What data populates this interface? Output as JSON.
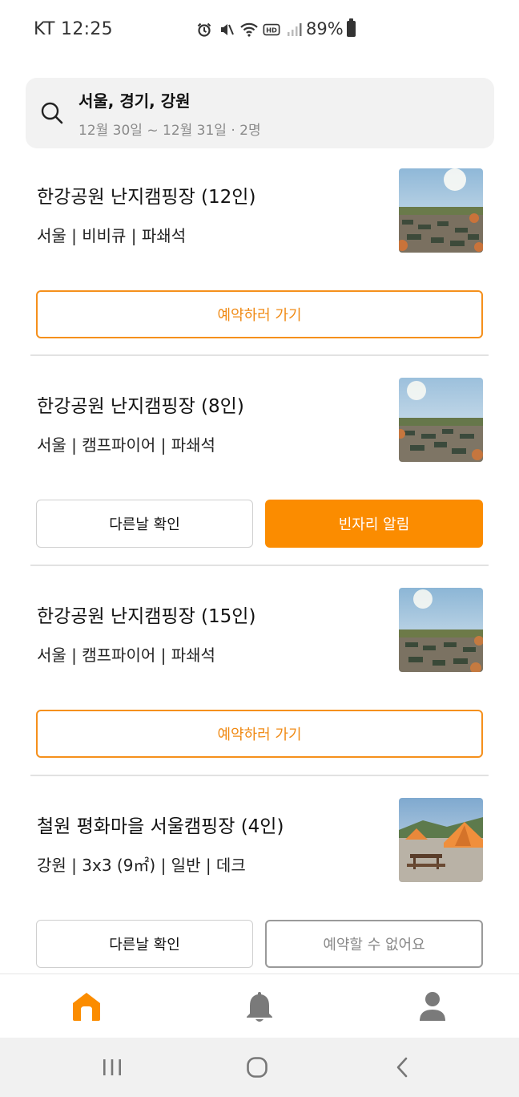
{
  "status_bar": {
    "carrier_time": "KT 12:25",
    "battery": "89%",
    "icons": [
      "alarm-icon",
      "mute-icon",
      "wifi-icon",
      "hd-icon",
      "signal-icon",
      "battery-icon"
    ]
  },
  "search": {
    "title": "서울, 경기, 강원",
    "subtitle": "12월 30일 ~ 12월 31일 · 2명",
    "icon": "search-icon"
  },
  "listings": [
    {
      "title": "한강공원 난지캠핑장 (12인)",
      "tags": "서울 | 비비큐 | 파쇄석",
      "buttons": [
        {
          "label": "예약하러 가기",
          "style": "outline-orange"
        }
      ]
    },
    {
      "title": "한강공원 난지캠핑장 (8인)",
      "tags": "서울 | 캠프파이어 | 파쇄석",
      "buttons": [
        {
          "label": "다른날 확인",
          "style": "outline-gray"
        },
        {
          "label": "빈자리 알림",
          "style": "solid-orange"
        }
      ]
    },
    {
      "title": "한강공원 난지캠핑장 (15인)",
      "tags": "서울 | 캠프파이어 | 파쇄석",
      "buttons": [
        {
          "label": "예약하러 가기",
          "style": "outline-orange"
        }
      ]
    },
    {
      "title": "철원 평화마을 서울캠핑장 (4인)",
      "tags": "강원 | 3x3 (9㎡) | 일반 | 데크",
      "buttons": [
        {
          "label": "다른날 확인",
          "style": "outline-gray"
        },
        {
          "label": "예약할 수 없어요",
          "style": "disabled"
        }
      ]
    }
  ],
  "bottom_nav": {
    "items": [
      "home-icon",
      "bell-icon",
      "profile-icon"
    ],
    "active": "home-icon"
  },
  "system_nav": [
    "recent-apps-icon",
    "home-circle-icon",
    "back-icon"
  ],
  "colors": {
    "accent": "#fb8c00",
    "accent_text": "#f08a14",
    "search_bg": "#f2f2f2",
    "muted_text": "#8a8a8a"
  }
}
